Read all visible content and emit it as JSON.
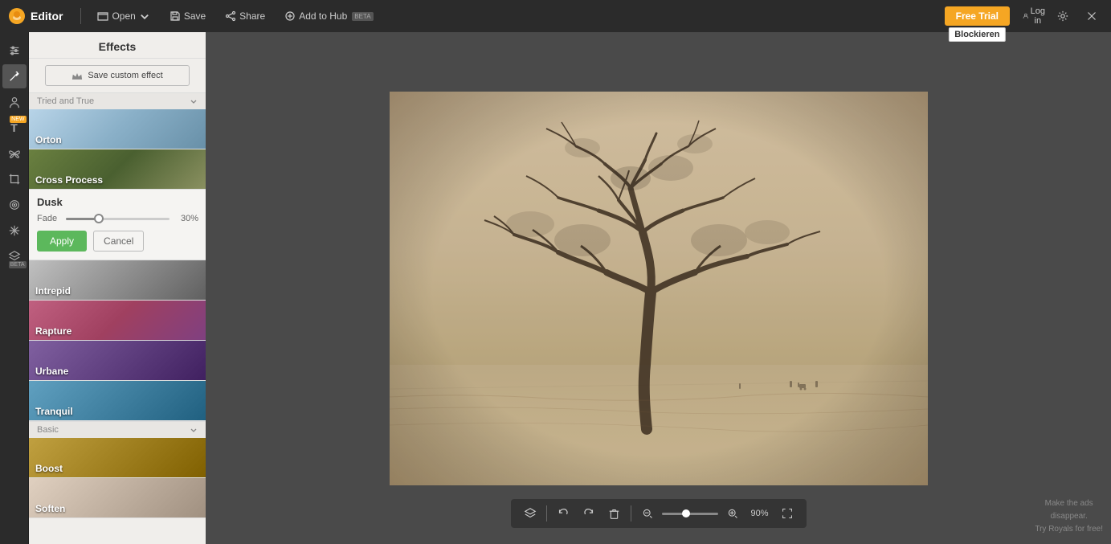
{
  "app": {
    "name": "Editor"
  },
  "topbar": {
    "open_label": "Open",
    "save_label": "Save",
    "share_label": "Share",
    "add_to_hub_label": "Add to Hub",
    "add_to_hub_badge": "BETA",
    "free_trial_label": "Free Trial",
    "login_label": "Log in",
    "blockieren_tooltip": "Blockieren"
  },
  "effects_panel": {
    "title": "Effects",
    "save_custom_label": "Save custom effect",
    "categories": [
      {
        "name": "tried-and-true",
        "label": "Tried and True",
        "items": [
          {
            "id": "orton",
            "label": "Orton",
            "has_crown": false
          },
          {
            "id": "crossprocess",
            "label": "Cross Process",
            "has_crown": false
          }
        ]
      }
    ],
    "selected_effect": {
      "name": "Dusk",
      "fade_label": "Fade",
      "fade_value": 30,
      "fade_unit": "%",
      "apply_label": "Apply",
      "cancel_label": "Cancel"
    },
    "more_effects": [
      {
        "id": "intrepid",
        "label": "Intrepid",
        "has_crown": true
      },
      {
        "id": "rapture",
        "label": "Rapture",
        "has_crown": true
      },
      {
        "id": "urbane",
        "label": "Urbane",
        "has_crown": true
      },
      {
        "id": "tranquil",
        "label": "Tranquil",
        "has_crown": true
      }
    ],
    "basic_category": {
      "label": "Basic",
      "items": [
        {
          "id": "boost",
          "label": "Boost"
        },
        {
          "id": "soften",
          "label": "Soften"
        }
      ]
    }
  },
  "bottom_toolbar": {
    "zoom_value": "90%"
  },
  "ad": {
    "line1": "Make the ads",
    "line2": "disappear.",
    "line3": "Try Royals for free!"
  }
}
